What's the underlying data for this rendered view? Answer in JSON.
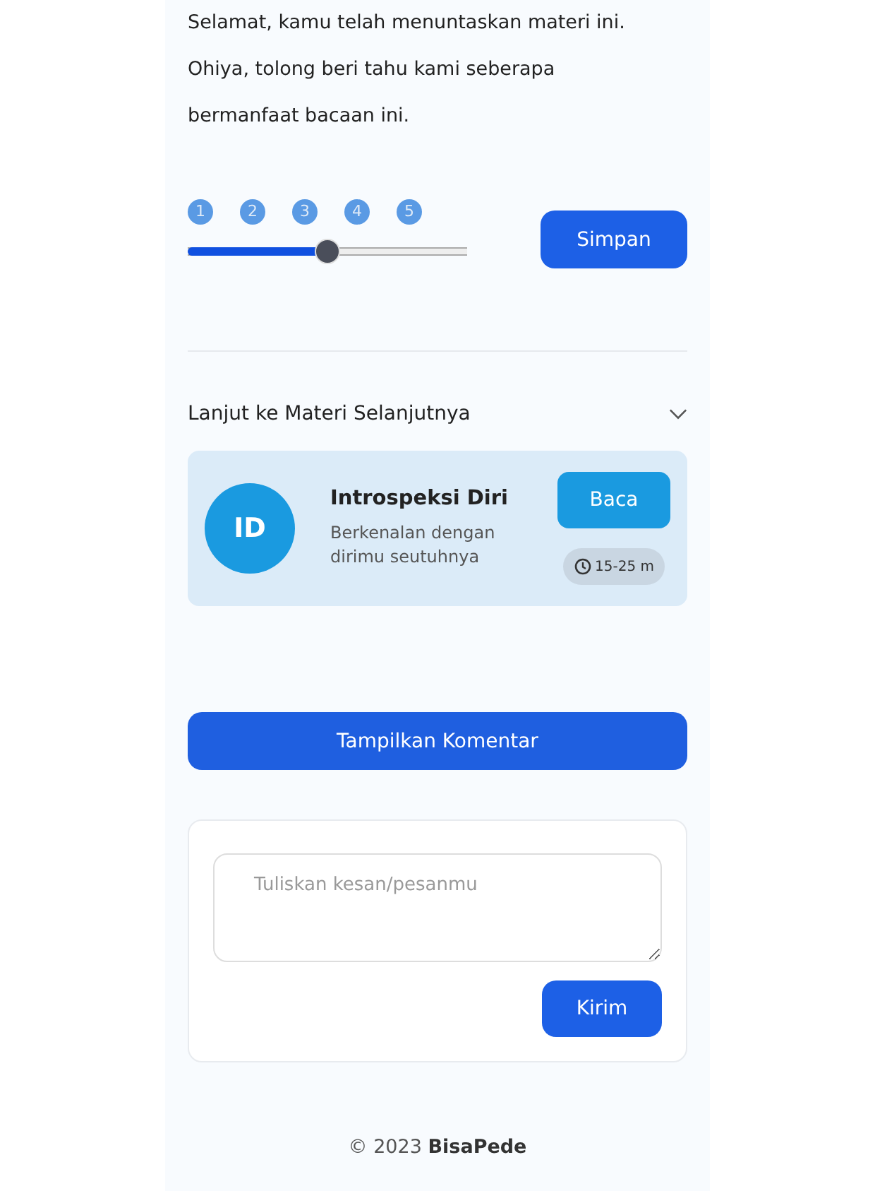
{
  "intro": [
    "Selamat, kamu telah menuntaskan materi ini.",
    "Ohiya, tolong beri tahu kami seberapa",
    "bermanfaat bacaan ini."
  ],
  "rating": {
    "steps": [
      "1",
      "2",
      "3",
      "4",
      "5"
    ],
    "level": 0.5,
    "button": "Simpan"
  },
  "next": {
    "title": "Lanjut ke Materi Selanjutnya",
    "expanded": true,
    "card": {
      "initials": "ID",
      "title": "Introspeksi Diri",
      "description": "Berkenalan dengan dirimu seutuhnya",
      "button": "Baca",
      "duration": "15-25 m"
    }
  },
  "comments_button": "Tampilkan Komentar",
  "comment_form": {
    "placeholder": "Tuliskan kesan/pesanmu",
    "button": "Kirim"
  },
  "footer": "© 2023 **BisaPede**"
}
